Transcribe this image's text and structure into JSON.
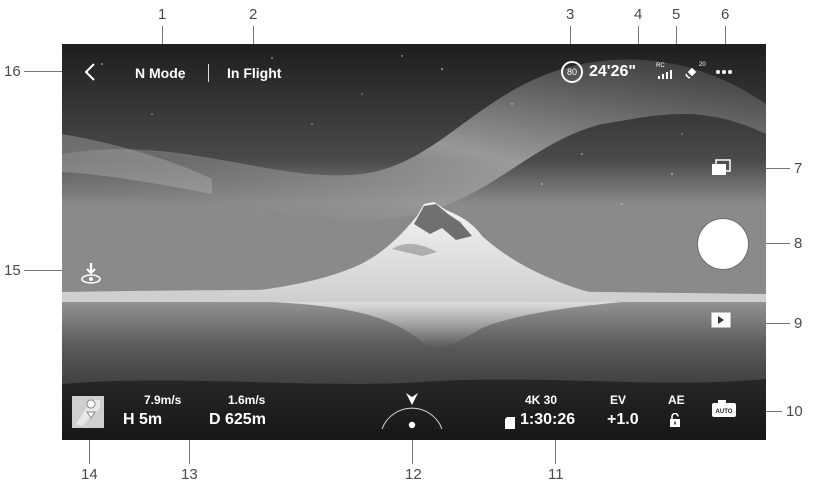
{
  "callouts": [
    "1",
    "2",
    "3",
    "4",
    "5",
    "6",
    "7",
    "8",
    "9",
    "10",
    "11",
    "12",
    "13",
    "14",
    "15",
    "16"
  ],
  "top_bar": {
    "mode": "N Mode",
    "status": "In Flight",
    "battery_percent": "80",
    "flight_time": "24'26\"",
    "rc_label": "RC",
    "gps_count": "20"
  },
  "telemetry": {
    "vertical_speed": "7.9m/s",
    "horizontal_speed": "1.6m/s",
    "height": "H 5m",
    "distance": "D 625m"
  },
  "camera": {
    "resolution_fps": "4K 30",
    "record_time": "1:30:26",
    "ev_label": "EV",
    "ev_value": "+1.0",
    "ae_label": "AE",
    "auto_label": "AUTO"
  },
  "colors": {
    "overlay_text": "#ffffff",
    "callout_text": "#4a4a4a",
    "callout_line": "#777777"
  }
}
